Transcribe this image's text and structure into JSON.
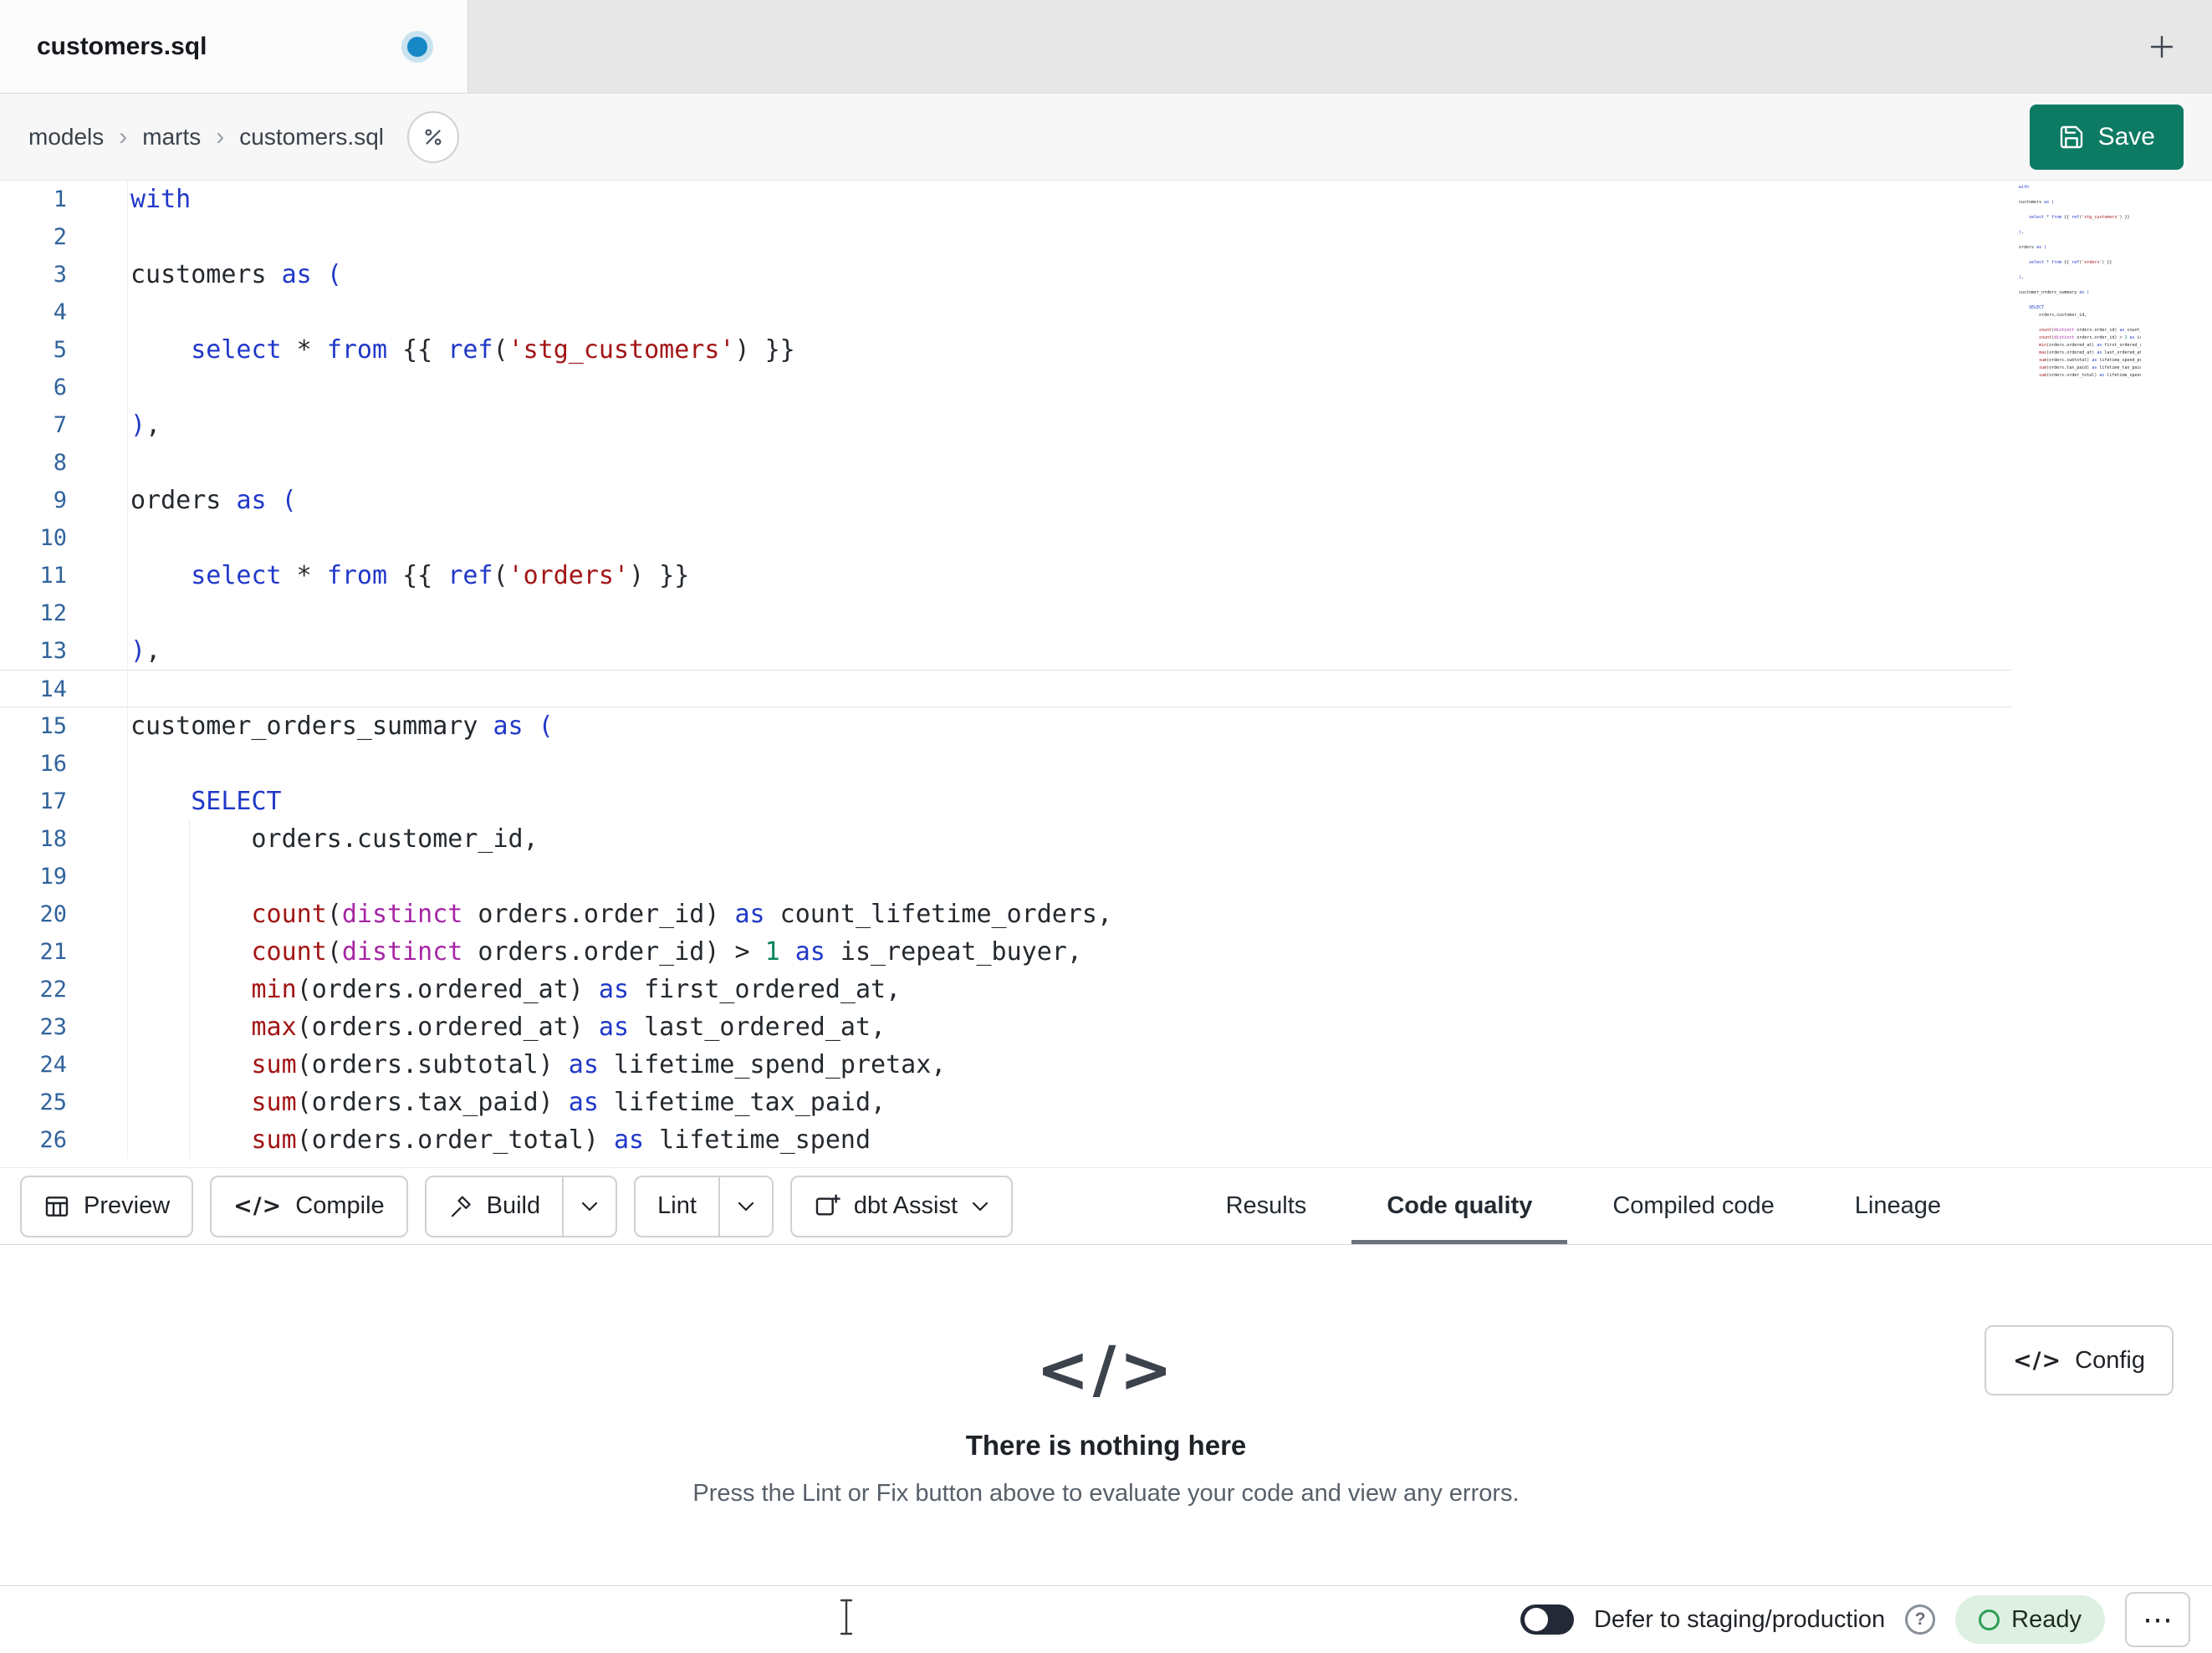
{
  "window": {
    "tab_title": "customers.sql"
  },
  "breadcrumb": {
    "items": [
      "models",
      "marts",
      "customers.sql"
    ],
    "separator": "›"
  },
  "actions": {
    "save": "Save"
  },
  "editor": {
    "lines": [
      {
        "n": 1,
        "tokens": [
          {
            "t": "with",
            "c": "kw"
          }
        ]
      },
      {
        "n": 2,
        "tokens": []
      },
      {
        "n": 3,
        "tokens": [
          {
            "t": "customers ",
            "c": "txt"
          },
          {
            "t": "as",
            "c": "kw"
          },
          {
            "t": " ",
            "c": "txt"
          },
          {
            "t": "(",
            "c": "br"
          }
        ]
      },
      {
        "n": 4,
        "tokens": []
      },
      {
        "n": 5,
        "tokens": [
          {
            "t": "    ",
            "c": "txt"
          },
          {
            "t": "select",
            "c": "kw"
          },
          {
            "t": " * ",
            "c": "txt"
          },
          {
            "t": "from",
            "c": "kw"
          },
          {
            "t": " {{ ",
            "c": "txt"
          },
          {
            "t": "ref",
            "c": "kw"
          },
          {
            "t": "(",
            "c": "txt"
          },
          {
            "t": "'stg_customers'",
            "c": "str"
          },
          {
            "t": ") }}",
            "c": "txt"
          }
        ]
      },
      {
        "n": 6,
        "tokens": []
      },
      {
        "n": 7,
        "tokens": [
          {
            "t": ")",
            "c": "br"
          },
          {
            "t": ",",
            "c": "txt"
          }
        ]
      },
      {
        "n": 8,
        "tokens": []
      },
      {
        "n": 9,
        "tokens": [
          {
            "t": "orders ",
            "c": "txt"
          },
          {
            "t": "as",
            "c": "kw"
          },
          {
            "t": " ",
            "c": "txt"
          },
          {
            "t": "(",
            "c": "br"
          }
        ]
      },
      {
        "n": 10,
        "tokens": []
      },
      {
        "n": 11,
        "tokens": [
          {
            "t": "    ",
            "c": "txt"
          },
          {
            "t": "select",
            "c": "kw"
          },
          {
            "t": " * ",
            "c": "txt"
          },
          {
            "t": "from",
            "c": "kw"
          },
          {
            "t": " {{ ",
            "c": "txt"
          },
          {
            "t": "ref",
            "c": "kw"
          },
          {
            "t": "(",
            "c": "txt"
          },
          {
            "t": "'orders'",
            "c": "str"
          },
          {
            "t": ") }}",
            "c": "txt"
          }
        ]
      },
      {
        "n": 12,
        "tokens": []
      },
      {
        "n": 13,
        "tokens": [
          {
            "t": ")",
            "c": "br"
          },
          {
            "t": ",",
            "c": "txt"
          }
        ]
      },
      {
        "n": 14,
        "current": true,
        "tokens": []
      },
      {
        "n": 15,
        "tokens": [
          {
            "t": "customer_orders_summary ",
            "c": "txt"
          },
          {
            "t": "as",
            "c": "kw"
          },
          {
            "t": " ",
            "c": "txt"
          },
          {
            "t": "(",
            "c": "br"
          }
        ]
      },
      {
        "n": 16,
        "tokens": []
      },
      {
        "n": 17,
        "tokens": [
          {
            "t": "    ",
            "c": "txt"
          },
          {
            "t": "SELECT",
            "c": "kw"
          }
        ]
      },
      {
        "n": 18,
        "g": 1,
        "tokens": [
          {
            "t": "        orders.customer_id,",
            "c": "txt"
          }
        ]
      },
      {
        "n": 19,
        "g": 1,
        "tokens": []
      },
      {
        "n": 20,
        "g": 1,
        "tokens": [
          {
            "t": "        ",
            "c": "txt"
          },
          {
            "t": "count",
            "c": "fn"
          },
          {
            "t": "(",
            "c": "txt"
          },
          {
            "t": "distinct",
            "c": "typ"
          },
          {
            "t": " orders.order_id) ",
            "c": "txt"
          },
          {
            "t": "as",
            "c": "kw"
          },
          {
            "t": " count_lifetime_orders,",
            "c": "txt"
          }
        ]
      },
      {
        "n": 21,
        "g": 1,
        "tokens": [
          {
            "t": "        ",
            "c": "txt"
          },
          {
            "t": "count",
            "c": "fn"
          },
          {
            "t": "(",
            "c": "txt"
          },
          {
            "t": "distinct",
            "c": "typ"
          },
          {
            "t": " orders.order_id) > ",
            "c": "txt"
          },
          {
            "t": "1",
            "c": "num"
          },
          {
            "t": " ",
            "c": "txt"
          },
          {
            "t": "as",
            "c": "kw"
          },
          {
            "t": " is_repeat_buyer,",
            "c": "txt"
          }
        ]
      },
      {
        "n": 22,
        "g": 1,
        "tokens": [
          {
            "t": "        ",
            "c": "txt"
          },
          {
            "t": "min",
            "c": "fn"
          },
          {
            "t": "(orders.ordered_at) ",
            "c": "txt"
          },
          {
            "t": "as",
            "c": "kw"
          },
          {
            "t": " first_ordered_at,",
            "c": "txt"
          }
        ]
      },
      {
        "n": 23,
        "g": 1,
        "tokens": [
          {
            "t": "        ",
            "c": "txt"
          },
          {
            "t": "max",
            "c": "fn"
          },
          {
            "t": "(orders.ordered_at) ",
            "c": "txt"
          },
          {
            "t": "as",
            "c": "kw"
          },
          {
            "t": " last_ordered_at,",
            "c": "txt"
          }
        ]
      },
      {
        "n": 24,
        "g": 1,
        "tokens": [
          {
            "t": "        ",
            "c": "txt"
          },
          {
            "t": "sum",
            "c": "fn"
          },
          {
            "t": "(orders.subtotal) ",
            "c": "txt"
          },
          {
            "t": "as",
            "c": "kw"
          },
          {
            "t": " lifetime_spend_pretax,",
            "c": "txt"
          }
        ]
      },
      {
        "n": 25,
        "g": 1,
        "tokens": [
          {
            "t": "        ",
            "c": "txt"
          },
          {
            "t": "sum",
            "c": "fn"
          },
          {
            "t": "(orders.tax_paid) ",
            "c": "txt"
          },
          {
            "t": "as",
            "c": "kw"
          },
          {
            "t": " lifetime_tax_paid,",
            "c": "txt"
          }
        ]
      },
      {
        "n": 26,
        "g": 1,
        "tokens": [
          {
            "t": "        ",
            "c": "txt"
          },
          {
            "t": "sum",
            "c": "fn"
          },
          {
            "t": "(orders.order_total) ",
            "c": "txt"
          },
          {
            "t": "as",
            "c": "kw"
          },
          {
            "t": " lifetime_spend",
            "c": "txt"
          }
        ]
      }
    ]
  },
  "toolbar": {
    "preview": "Preview",
    "compile": "Compile",
    "build": "Build",
    "lint": "Lint",
    "assist": "dbt Assist",
    "tabs": [
      {
        "label": "Results",
        "active": false
      },
      {
        "label": "Code quality",
        "active": true
      },
      {
        "label": "Compiled code",
        "active": false
      },
      {
        "label": "Lineage",
        "active": false
      }
    ]
  },
  "results_panel": {
    "empty_title": "There is nothing here",
    "empty_description": "Press the Lint or Fix button above to evaluate your code and view any errors.",
    "config": "Config"
  },
  "status_bar": {
    "defer_label": "Defer to staging/production",
    "ready": "Ready"
  },
  "icons": {
    "code_glyph": "</>",
    "ellipsis": "⋯",
    "help": "?"
  },
  "colors": {
    "save_button": "#0d7a64",
    "keyword": "#2038c8",
    "function": "#a31515",
    "string": "#a31515",
    "number": "#098658",
    "distinct_keyword": "#a626a4",
    "line_number": "#31639c",
    "modified_dot": "#1787c6",
    "ready_badge_bg": "#ddf0e2",
    "ready_badge_ring": "#2f9e53",
    "active_tab_underline": "#6a727d"
  }
}
